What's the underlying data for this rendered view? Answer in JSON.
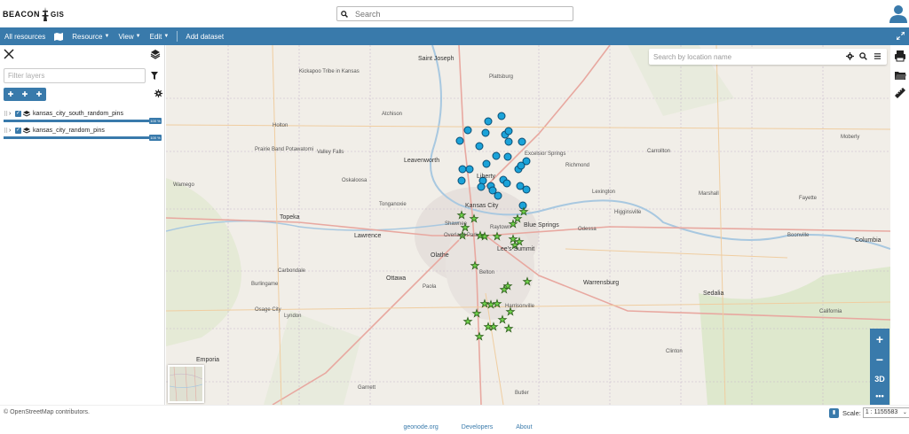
{
  "app": {
    "logo_word1": "BEACON",
    "logo_word2": "GIS",
    "search_placeholder": "Search"
  },
  "menubar": {
    "all_resources": "All resources",
    "resource": "Resource",
    "view": "View",
    "edit": "Edit",
    "add_dataset": "Add dataset"
  },
  "panel": {
    "filter_placeholder": "Filter layers",
    "layers": [
      {
        "name": "kansas_city_south_random_pins",
        "opacity": "100 %"
      },
      {
        "name": "kansas_city_random_pins",
        "opacity": "100 %"
      }
    ]
  },
  "map": {
    "location_search_placeholder": "Search by location name",
    "zoom_in": "+",
    "zoom_out": "−",
    "three_d": "3D",
    "more": "•••",
    "labels": {
      "saint_joseph": "Saint Joseph",
      "plattsburg": "Plattsburg",
      "leavenworth": "Leavenworth",
      "kansas_city": "Kansas City",
      "liberty": "Liberty",
      "excelsior_springs": "Excelsior Springs",
      "topeka": "Topeka",
      "lawrence": "Lawrence",
      "olathe": "Olathe",
      "lees_summit": "Lee's Summit",
      "blue_springs": "Blue Springs",
      "overland_park": "Overland Park",
      "shawnee": "Shawnee",
      "raytown": "Raytown",
      "belton": "Belton",
      "harrisonville": "Harrisonville",
      "warrensburg": "Warrensburg",
      "sedalia": "Sedalia",
      "columbia": "Columbia",
      "boonville": "Boonville",
      "carrollton": "Carrollton",
      "moberly": "Moberly",
      "emporia": "Emporia",
      "ottawa": "Ottawa",
      "paola": "Paola",
      "garnett": "Garnett",
      "butler": "Butler",
      "clinton": "Clinton",
      "osage_city": "Osage City",
      "lyndon": "Lyndon",
      "carbondale": "Carbondale",
      "burlingame": "Burlingame",
      "holton": "Holton",
      "atchison": "Atchison",
      "valley_falls": "Valley Falls",
      "oskaloosa": "Oskaloosa",
      "tonganoxie": "Tonganoxie",
      "odessa": "Odessa",
      "higginsville": "Higginsville",
      "lexington": "Lexington",
      "richmond": "Richmond",
      "marshall": "Marshall",
      "fayette": "Fayette",
      "california": "California",
      "wamego": "Wamego",
      "mcpherson_note": "Kickapoo Tribe in Kansas",
      "prairie_band": "Prairie Band Potawatomi"
    }
  },
  "footer": {
    "attribution": "© OpenStreetMap contributors.",
    "scale_label": "Scale:",
    "scale_value": "1 : 1155583",
    "links": [
      "geonode.org",
      "Developers",
      "About"
    ]
  },
  "colors": {
    "accent": "#397AAB",
    "pin_circle": "#1BA3D9",
    "pin_star": "#6FD14A"
  },
  "icons": {
    "search": "search-icon",
    "avatar": "user-avatar-icon",
    "close": "close-icon",
    "layers": "layers-icon",
    "filter": "filter-icon",
    "gear": "gear-icon",
    "print": "print-icon",
    "folder": "folder-icon",
    "ruler": "ruler-icon",
    "expand": "expand-icon",
    "map": "map-icon"
  }
}
